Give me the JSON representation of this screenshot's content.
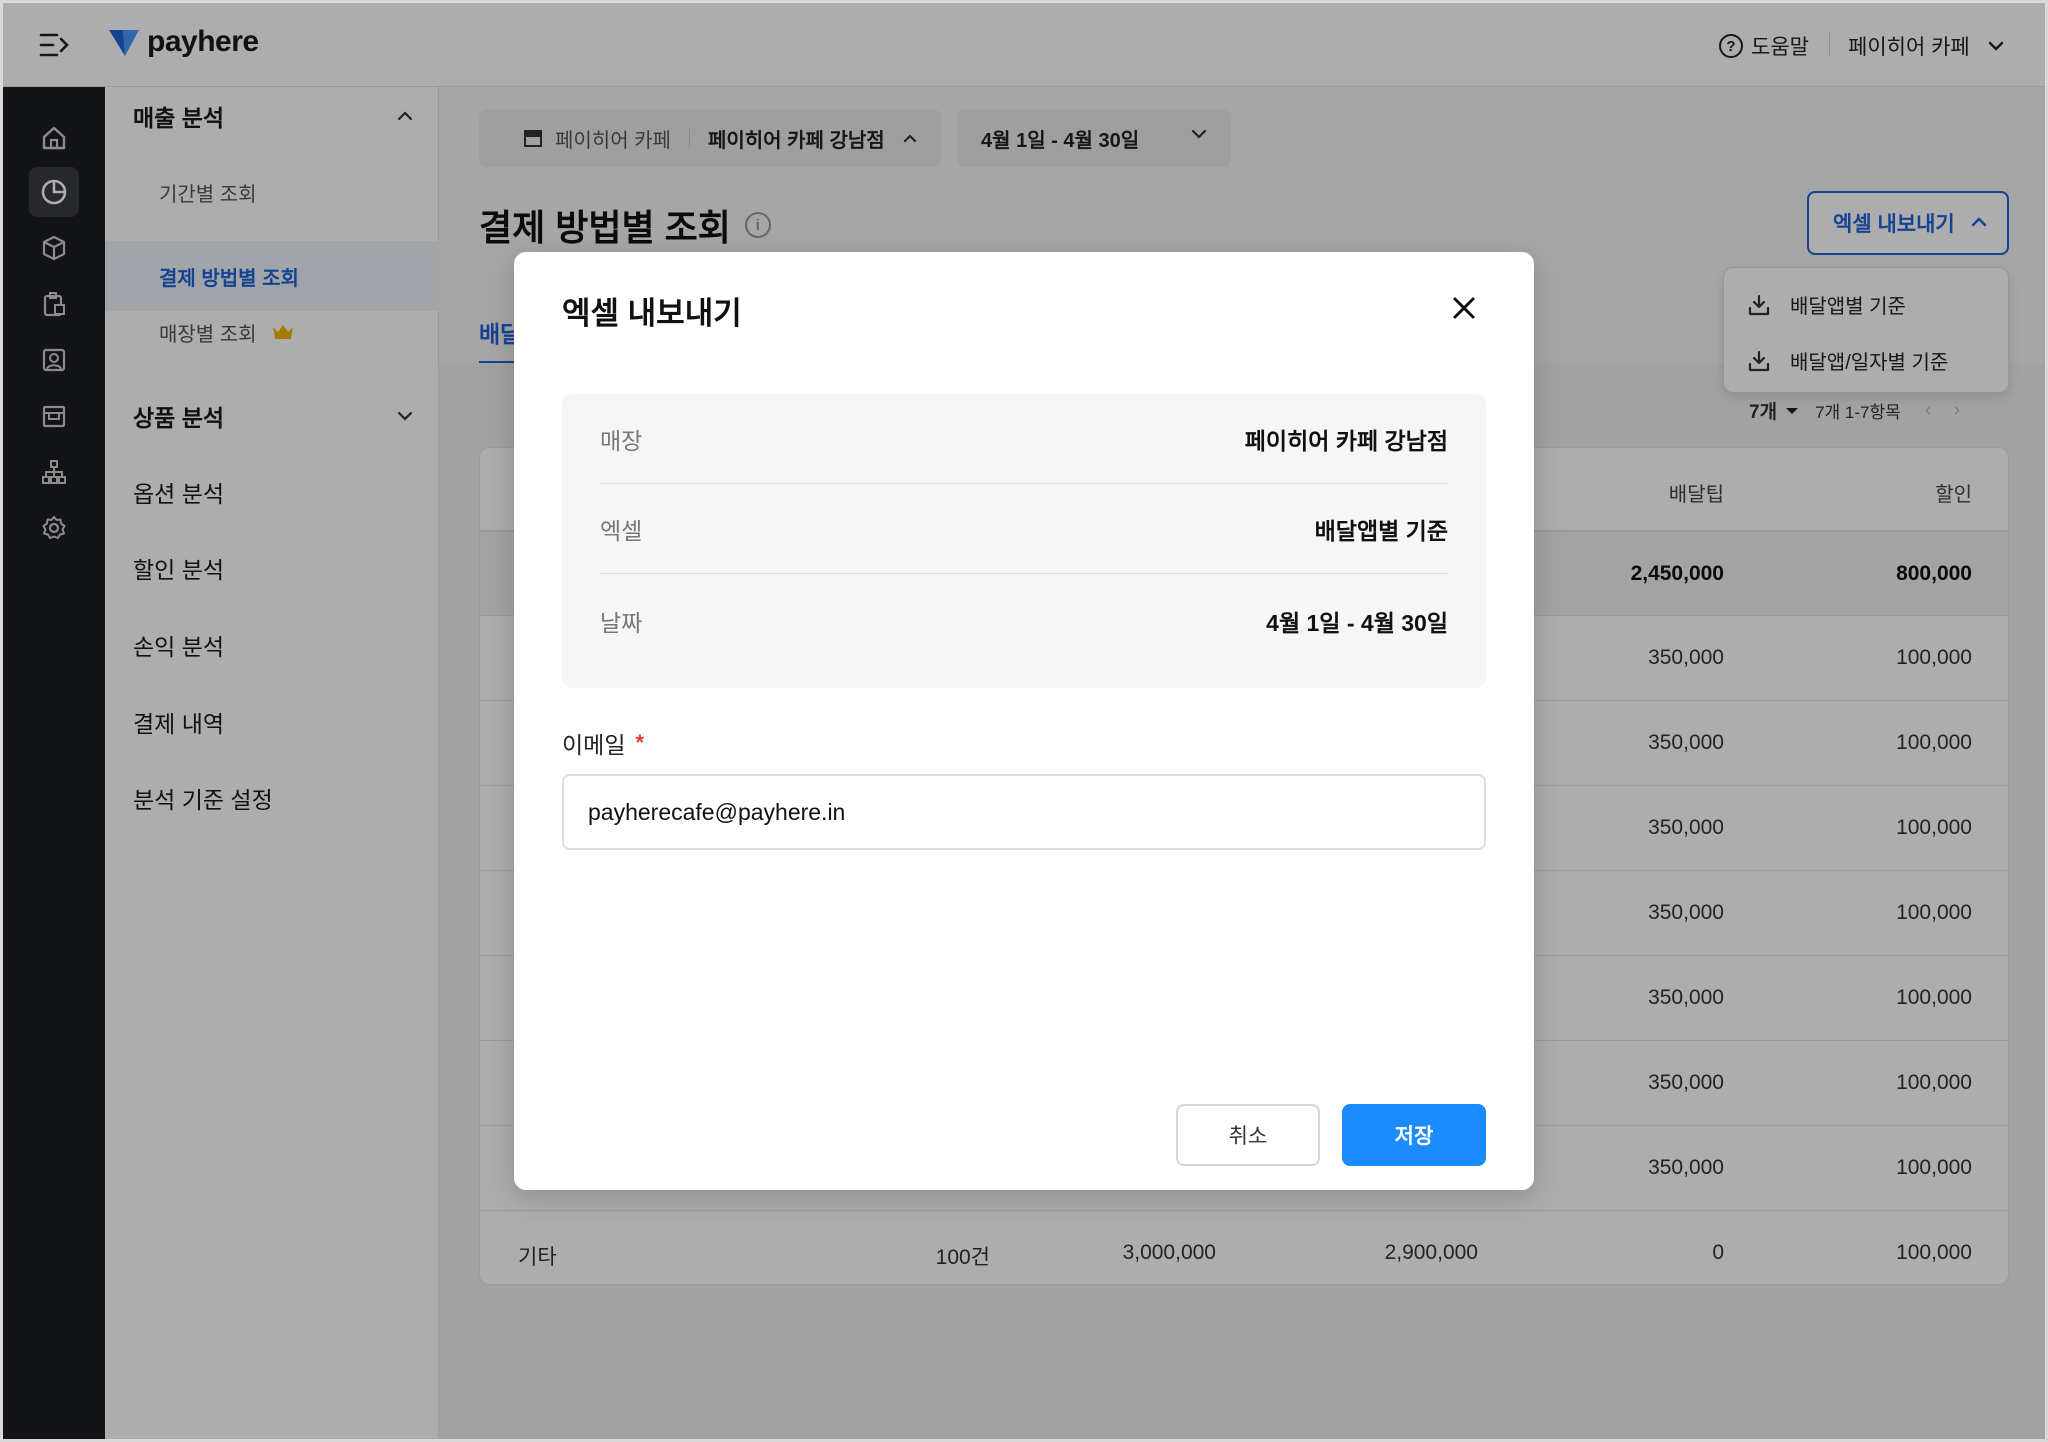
{
  "header": {
    "logo_text": "payhere",
    "help_label": "도움말",
    "store_name": "페이히어 카페"
  },
  "sidebar": {
    "groups": [
      {
        "label": "매출 분석",
        "expanded": true
      },
      {
        "label": "상품 분석",
        "expanded": false
      }
    ],
    "sub_items": [
      {
        "label": "기간별 조회"
      },
      {
        "label": "결제 방법별 조회",
        "active": true
      },
      {
        "label": "매장별 조회",
        "premium": true
      }
    ],
    "items": [
      {
        "label": "옵션 분석"
      },
      {
        "label": "할인 분석"
      },
      {
        "label": "손익 분석"
      },
      {
        "label": "결제 내역"
      },
      {
        "label": "분석 기준 설정"
      }
    ]
  },
  "filters": {
    "brand": "페이히어 카페",
    "branch": "페이히어 카페 강남점",
    "date_range": "4월 1일 - 4월 30일"
  },
  "page": {
    "title": "결제 방법별 조회",
    "active_tab": "배달",
    "export_button": "엑셀 내보내기",
    "export_options": [
      "배달앱별 기준",
      "배달앱/일자별 기준"
    ]
  },
  "pagination": {
    "per_page": "7개",
    "range": "7개 1-7항목"
  },
  "table": {
    "headers": [
      "배달팁",
      "할인"
    ],
    "summary": [
      "2,450,000",
      "800,000"
    ],
    "rows": [
      [
        "350,000",
        "100,000"
      ],
      [
        "350,000",
        "100,000"
      ],
      [
        "350,000",
        "100,000"
      ],
      [
        "350,000",
        "100,000"
      ],
      [
        "350,000",
        "100,000"
      ],
      [
        "350,000",
        "100,000"
      ],
      [
        "350,000",
        "100,000"
      ]
    ],
    "last_row": [
      "기타",
      "100건",
      "3,000,000",
      "2,900,000",
      "0",
      "100,000"
    ]
  },
  "modal": {
    "title": "엑셀 내보내기",
    "fields": [
      {
        "label": "매장",
        "value": "페이히어 카페 강남점"
      },
      {
        "label": "엑셀",
        "value": "배달앱별 기준"
      },
      {
        "label": "날짜",
        "value": "4월 1일 - 4월 30일"
      }
    ],
    "email_label": "이메일",
    "required_mark": "*",
    "email_value": "payherecafe@payhere.in",
    "cancel_label": "취소",
    "save_label": "저장"
  },
  "colors": {
    "primary": "#1a8cff",
    "accent_blue": "#1f63d6",
    "required": "#e03a3a",
    "rail_bg": "#1d1e22",
    "crown": "#f2b705"
  },
  "icons": [
    "menu-collapse-icon",
    "payhere-logo-icon",
    "help-icon",
    "chevron-down-icon",
    "home-icon",
    "pie-chart-icon",
    "box-icon",
    "clipboard-icon",
    "user-card-icon",
    "store-icon",
    "org-chart-icon",
    "gear-icon",
    "store-front-icon",
    "crown-icon",
    "info-icon",
    "download-icon",
    "close-icon"
  ]
}
